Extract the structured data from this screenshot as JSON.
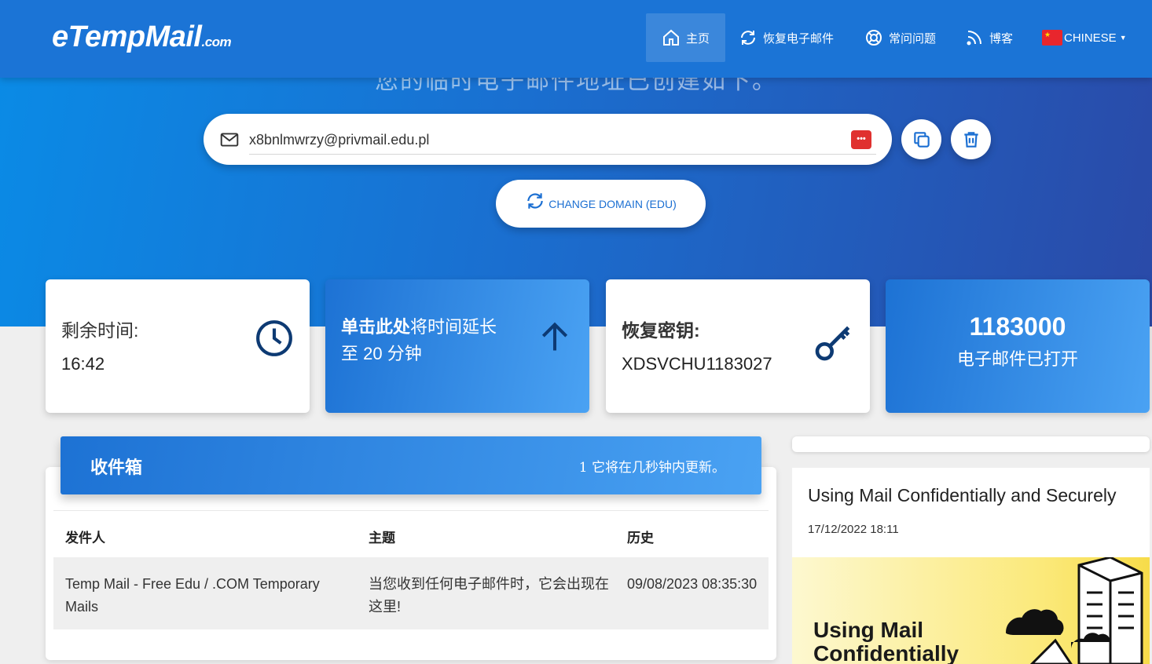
{
  "header": {
    "logo_main": "eTempMail",
    "logo_suffix": ".com",
    "nav": {
      "home": "主页",
      "recover": "恢复电子邮件",
      "faq": "常问问题",
      "blog": "博客",
      "language": "CHINESE"
    }
  },
  "hero": {
    "subtitle": "您的临时电子邮件地址已创建如下。"
  },
  "email": {
    "address": "x8bnlmwrzy@privmail.edu.pl",
    "change_domain_label": "CHANGE DOMAIN (EDU)"
  },
  "cards": {
    "time_label": "剩余时间:",
    "time_value": "16:42",
    "extend_bold": "单击此处",
    "extend_rest": "将时间延长",
    "extend_line2": "至 20 分钟",
    "recovery_label": "恢复密钥:",
    "recovery_value": "XDSVCHU1183027",
    "count_value": "1183000",
    "count_label": "电子邮件已打开"
  },
  "inbox": {
    "title": "收件箱",
    "status": "1 它将在几秒钟内更新。",
    "columns": [
      "发件人",
      "主题",
      "历史"
    ],
    "rows": [
      {
        "sender": "Temp Mail - Free Edu / .COM Temporary Mails",
        "subject": "当您收到任何电子邮件时，它会出现在这里!",
        "date": "09/08/2023 08:35:30"
      }
    ]
  },
  "blog": {
    "title": "Using Mail Confidentially and Securely",
    "date": "17/12/2022 18:11",
    "image_text_line1": "Using Mail",
    "image_text_line2": "Confidentially"
  },
  "colors": {
    "brand_blue": "#1b74d6",
    "accent_blue": "#1b6fd2",
    "icon_navy": "#0d3a73",
    "red_badge": "#e0312f"
  }
}
